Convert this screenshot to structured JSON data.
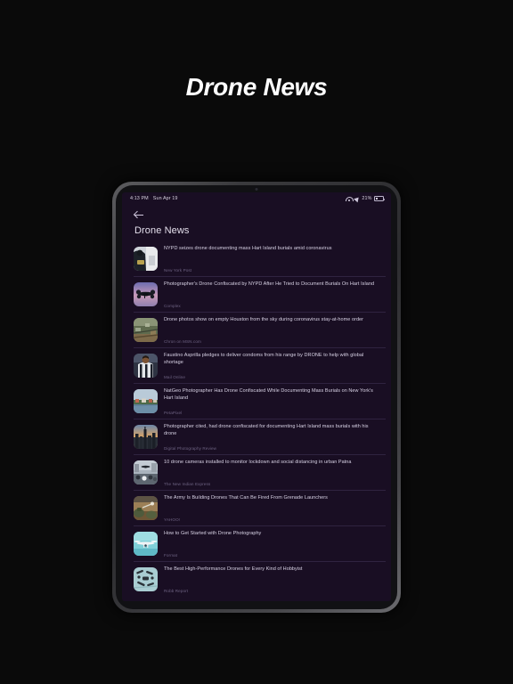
{
  "caption": "Drone News",
  "device": {
    "statusbar": {
      "time": "4:13 PM",
      "date": "Sun Apr 19",
      "battery_percent": "21%",
      "wifi_icon": "wifi-icon",
      "location_icon": "location-arrow-icon",
      "battery_icon": "battery-icon"
    },
    "appbar": {
      "back_icon": "back-arrow-icon",
      "title": "Drone News"
    },
    "news": [
      {
        "title": "NYPD seizes drone documenting mass Hart Island burials amid coronavirus",
        "source": "New York Post",
        "thumb": "person-with-drone-photo"
      },
      {
        "title": "Photographer's Drone Confiscated by NYPD After He Tried to Document Burials On Hart Island",
        "source": "Complex",
        "thumb": "quadcopter-pink-sky-photo"
      },
      {
        "title": "Drone photos show on empty Houston from the sky during coronavirus stay-at-home order",
        "source": "Chron on MSN.com",
        "thumb": "aerial-city-photo"
      },
      {
        "title": "Faustino Asprilla pledges to deliver condoms from his range by DRONE to help with global shortage",
        "source": "Mail Online",
        "thumb": "footballer-portrait-photo"
      },
      {
        "title": "NatGeo Photographer Has Drone Confiscated While Documenting Mass Burials on New York's Hart Island",
        "source": "PetaPixel",
        "thumb": "island-waterfront-photo"
      },
      {
        "title": "Photographer cited, had drone confiscated for documenting Hart Island mass burials with his drone",
        "source": "Digital Photography Review",
        "thumb": "city-skyline-dusk-photo"
      },
      {
        "title": "10 drone cameras installed to monitor lockdown and social distancing in urban Patna",
        "source": "The New Indian Express",
        "thumb": "street-drone-photo"
      },
      {
        "title": "The Army Is Building Drones That Can Be Fired From Grenade Launchers",
        "source": "YAHOO!",
        "thumb": "soldiers-desert-photo"
      },
      {
        "title": "How to Get Started with Drone Photography",
        "source": "Format",
        "thumb": "white-drone-sky-photo"
      },
      {
        "title": "The Best High-Performance Drones for Every Kind of Hobbyist",
        "source": "Robb Report",
        "thumb": "drone-collection-photo"
      }
    ]
  },
  "colors": {
    "page_background": "#0a0a0a",
    "screen_background": "#190e23",
    "divider": "#2f2340",
    "title_text": "#d9d3e6",
    "source_text": "#6e6383"
  }
}
